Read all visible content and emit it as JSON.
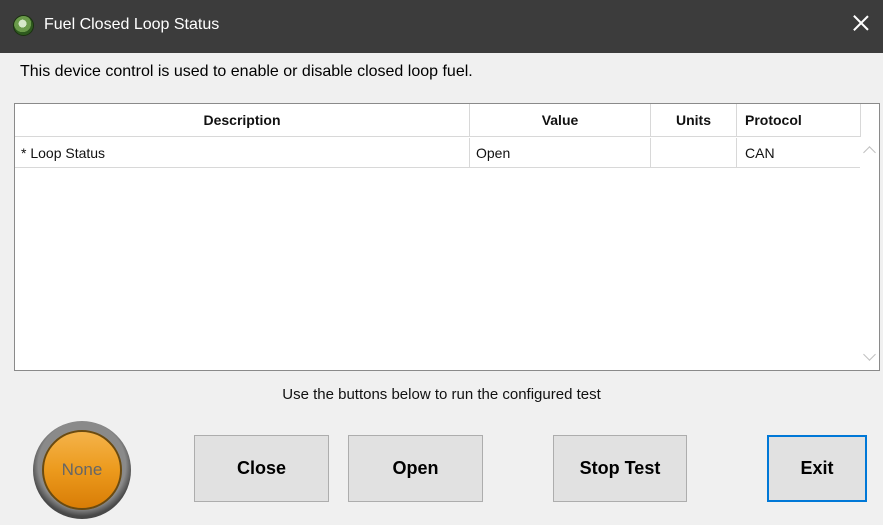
{
  "window": {
    "title": "Fuel Closed Loop Status"
  },
  "info_text": "This device control is used to enable or disable closed loop fuel.",
  "grid": {
    "columns": [
      "Description",
      "Value",
      "Units",
      "Protocol"
    ],
    "rows": [
      {
        "description": "* Loop Status",
        "value": "Open",
        "units": "",
        "protocol": "CAN"
      }
    ]
  },
  "hint_text": "Use the buttons below to run the configured test",
  "status_indicator": {
    "label": "None",
    "color": "#ec9a1d"
  },
  "buttons": {
    "close": "Close",
    "open": "Open",
    "stop_test": "Stop Test",
    "exit": "Exit"
  },
  "colors": {
    "titlebar": "#3c3c3c",
    "focus_border": "#0078d7"
  }
}
